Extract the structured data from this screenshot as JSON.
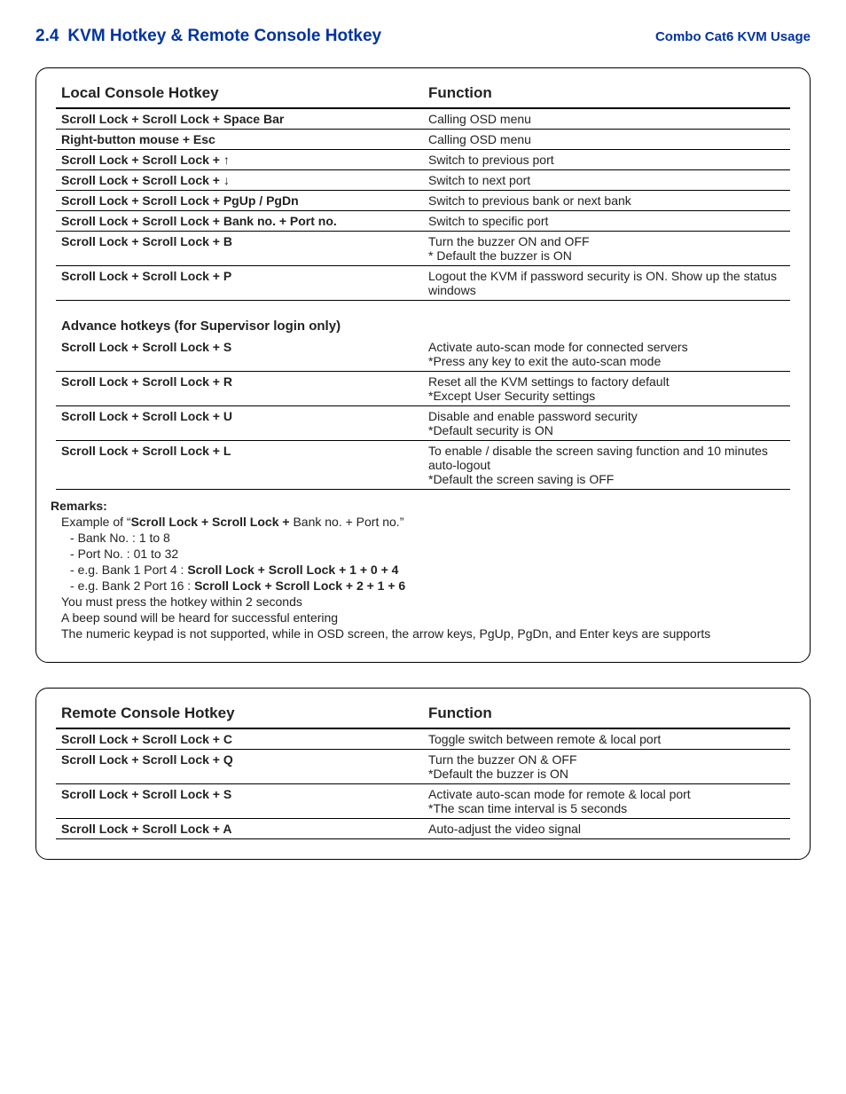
{
  "header": {
    "section_no": "2.4",
    "section_title": "KVM Hotkey & Remote Console Hotkey",
    "usage": "Combo Cat6 KVM Usage"
  },
  "local": {
    "col1": "Local Console Hotkey",
    "col2": "Function",
    "rows": [
      {
        "key": "Scroll Lock  +  Scroll Lock  +   Space Bar",
        "fn": "Calling OSD menu"
      },
      {
        "key": "Right-button mouse  +  Esc",
        "fn": "Calling OSD menu"
      },
      {
        "key": "Scroll Lock  +  Scroll Lock  +    ↑",
        "fn": "Switch to previous port",
        "arrow": true
      },
      {
        "key": "Scroll Lock  +  Scroll Lock  +    ↓",
        "fn": "Switch to next port",
        "arrow": true
      },
      {
        "key": "Scroll Lock  +  Scroll Lock  +   PgUp / PgDn",
        "fn": "Switch to previous bank or next bank"
      },
      {
        "key": "Scroll Lock  +  Scroll Lock  +   Bank no.  +  Port no.",
        "fn": "Switch to specific port"
      },
      {
        "key": "Scroll Lock  +  Scroll Lock  +   B",
        "fn": "Turn the buzzer ON and OFF\n* Default the buzzer is ON"
      },
      {
        "key": "Scroll Lock  +  Scroll Lock  +   P",
        "fn": "Logout the KVM if password security is ON.  Show up the status windows"
      }
    ],
    "adv_title": "Advance hotkeys (for Supervisor login only)",
    "adv_rows": [
      {
        "key": "Scroll Lock  +  Scroll Lock  +   S",
        "fn": "Activate auto-scan mode for connected servers\n*Press any key to exit the auto-scan mode"
      },
      {
        "key": "Scroll Lock  +  Scroll Lock  +   R",
        "fn": "Reset all the KVM settings to factory default\n*Except User Security settings"
      },
      {
        "key": "Scroll Lock  +  Scroll Lock  +   U",
        "fn": "Disable and enable password security\n*Default security is ON"
      },
      {
        "key": "Scroll Lock  +  Scroll Lock  +   L",
        "fn": "To enable / disable the screen saving function and 10 minutes auto-logout\n*Default the screen saving is OFF"
      }
    ],
    "remarks": {
      "title": "Remarks:",
      "example_prefix": "Example of “",
      "example_bold": "Scroll Lock  +  Scroll Lock  +",
      "example_suffix": "   Bank no.  +  Port no.”",
      "bank": "Bank No. :  1 to 8",
      "port": "Port No. :  01 to 32",
      "eg1_pre": "e.g. Bank 1 Port 4 :  ",
      "eg1_bold": "Scroll Lock   +   Scroll Lock   +   1   +   0   +   4",
      "eg2_pre": "e.g. Bank 2 Port 16 :  ",
      "eg2_bold": "Scroll Lock   +   Scroll Lock   +   2   +   1   +   6",
      "within": "You must press the hotkey within 2 seconds",
      "beep": "A beep sound will be heard for successful entering",
      "keypad": "The numeric keypad is not supported, while in OSD screen, the arrow keys, PgUp, PgDn, and Enter keys are supports"
    }
  },
  "remote": {
    "col1": "Remote Console Hotkey",
    "col2": "Function",
    "rows": [
      {
        "key": "Scroll Lock  +  Scroll Lock  +   C",
        "fn": "Toggle switch between remote & local port"
      },
      {
        "key": "Scroll Lock  +  Scroll Lock  +   Q",
        "fn": "Turn the buzzer ON & OFF\n*Default the buzzer is ON"
      },
      {
        "key": "Scroll Lock  +  Scroll Lock  +   S",
        "fn": "Activate auto-scan mode for remote & local port\n*The scan time interval is 5 seconds"
      },
      {
        "key": "Scroll Lock  +  Scroll Lock  +   A",
        "fn": "Auto-adjust the video signal"
      }
    ]
  }
}
